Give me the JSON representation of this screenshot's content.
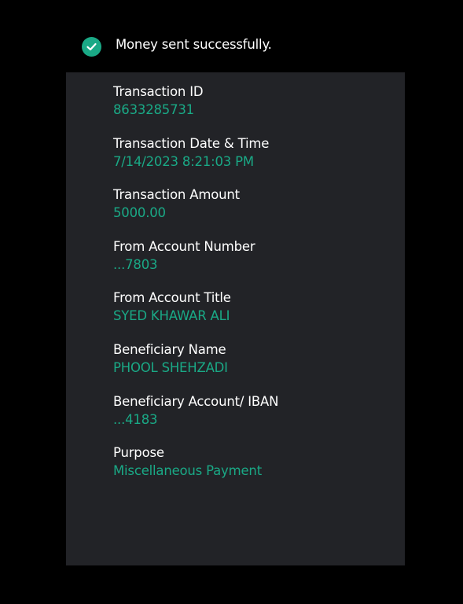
{
  "status": {
    "icon": "check-circle-icon",
    "message": "Money sent successfully."
  },
  "colors": {
    "background": "#000000",
    "panel": "#222327",
    "accent": "#1aa986",
    "label": "#ffffff"
  },
  "details": [
    {
      "label": "Transaction ID",
      "value": "8633285731"
    },
    {
      "label": "Transaction Date & Time",
      "value": "7/14/2023 8:21:03 PM"
    },
    {
      "label": "Transaction Amount",
      "value": "5000.00"
    },
    {
      "label": "From Account Number",
      "value": "...7803"
    },
    {
      "label": "From Account Title",
      "value": "SYED KHAWAR ALI"
    },
    {
      "label": "Beneficiary Name",
      "value": "PHOOL SHEHZADI"
    },
    {
      "label": "Beneficiary Account/ IBAN",
      "value": "...4183"
    },
    {
      "label": "Purpose",
      "value": "Miscellaneous Payment"
    }
  ]
}
